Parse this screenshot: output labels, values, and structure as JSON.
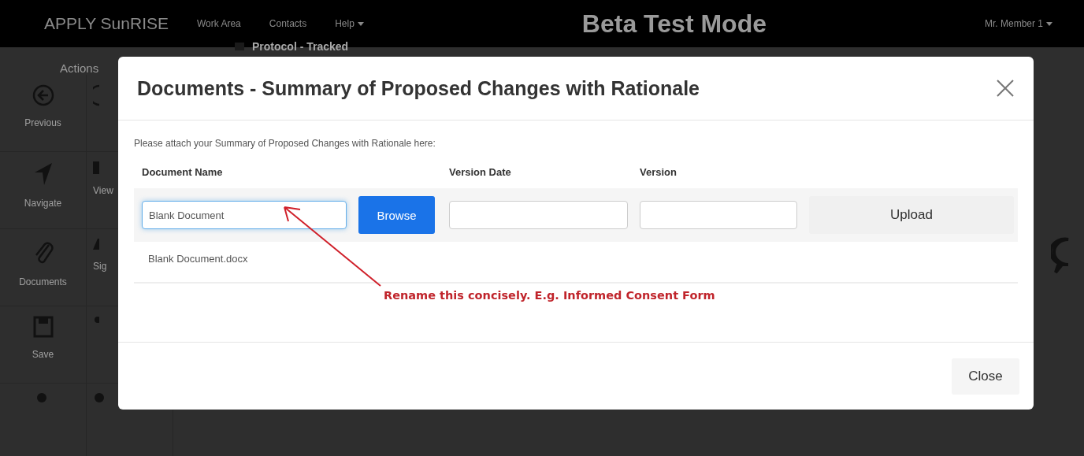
{
  "navbar": {
    "brand": "APPLY SunRISE",
    "links": [
      {
        "label": "Work Area",
        "dropdown": false
      },
      {
        "label": "Contacts",
        "dropdown": false
      },
      {
        "label": "Help",
        "dropdown": true
      }
    ],
    "mode": "Beta Test Mode",
    "user": {
      "label": "Mr. Member 1",
      "dropdown": true
    }
  },
  "page": {
    "heading": "Protocol - Tracked",
    "sidebar": {
      "title": "Actions",
      "columns": [
        [
          {
            "label": "Previous"
          },
          {
            "label": "Navigate"
          },
          {
            "label": "Documents"
          },
          {
            "label": "Save"
          },
          {}
        ],
        [
          {},
          {
            "label": "View"
          },
          {
            "label": "Sig"
          },
          {},
          {}
        ]
      ]
    }
  },
  "modal": {
    "title": "Documents - Summary of Proposed Changes with Rationale",
    "instruction": "Please attach your Summary of Proposed Changes with Rationale here:",
    "columns": [
      "Document Name",
      "Version Date",
      "Version"
    ],
    "row": {
      "document_name": {
        "value": "Blank Document",
        "focused": true
      },
      "browse_button": "Browse",
      "upload_button": "Upload",
      "file_name": "Blank Document.docx"
    },
    "annotation": "Rename this concisely. E.g. Informed Consent Form",
    "close_button": "Close"
  }
}
